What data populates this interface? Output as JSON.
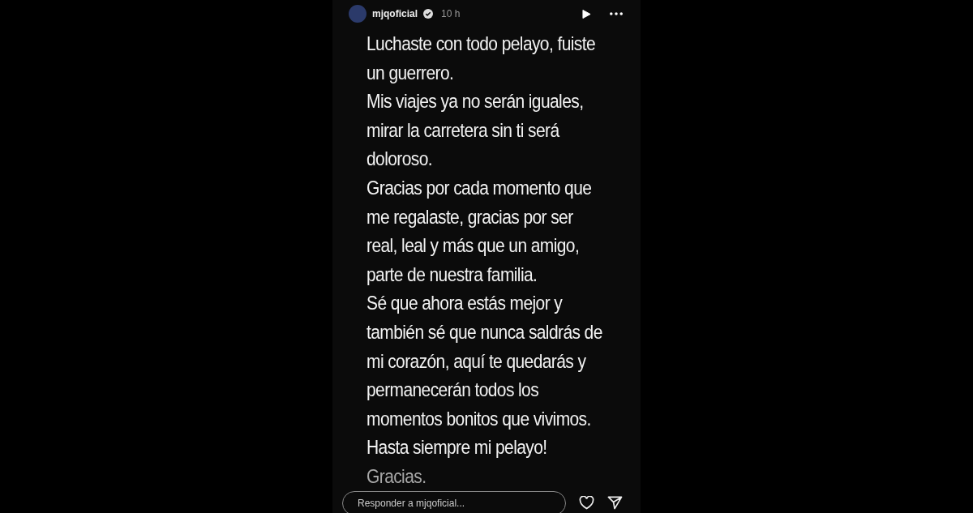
{
  "story": {
    "username": "mjqoficial",
    "verified": true,
    "time": "10 h",
    "lines": [
      {
        "text": "Luchaste con todo pelayo, fuiste",
        "faded": false
      },
      {
        "text": "un guerrero.",
        "faded": false
      },
      {
        "text": "Mis viajes ya no serán iguales,",
        "faded": false
      },
      {
        "text": "mirar la carretera sin ti será",
        "faded": false
      },
      {
        "text": "doloroso.",
        "faded": false
      },
      {
        "text": "Gracias por cada momento que",
        "faded": false
      },
      {
        "text": "me regalaste, gracias por ser",
        "faded": false
      },
      {
        "text": "real, leal y más que un amigo,",
        "faded": false
      },
      {
        "text": "parte de nuestra familia.",
        "faded": false
      },
      {
        "text": "Sé que ahora estás mejor y",
        "faded": false
      },
      {
        "text": "también sé que nunca saldrás de",
        "faded": false
      },
      {
        "text": "mi corazón, aquí te quedarás y",
        "faded": false
      },
      {
        "text": "permanecerán todos los",
        "faded": false
      },
      {
        "text": "momentos bonitos que vivimos.",
        "faded": false
      },
      {
        "text": "Hasta siempre mi pelayo!",
        "faded": false
      },
      {
        "text": "Gracias.",
        "faded": true
      }
    ],
    "reply": {
      "placeholder": "Responder a mjqoficial..."
    }
  }
}
